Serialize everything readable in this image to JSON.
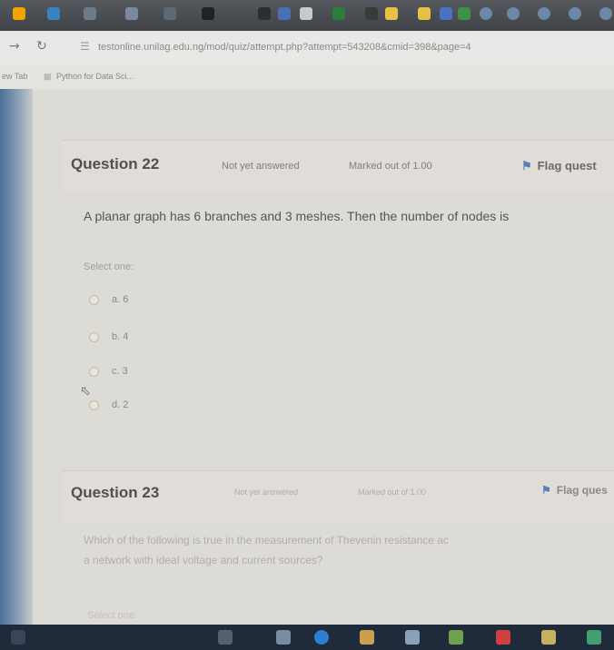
{
  "browser": {
    "url": "testonline.unilag.edu.ng/mod/quiz/attempt.php?attempt=543208&cmid=398&page=4",
    "bookmarks": [
      "ew Tab",
      "Python for Data Sci..."
    ]
  },
  "questions": [
    {
      "number": "Question 22",
      "state": "Not yet answered",
      "marks": "Marked out of 1.00",
      "flag_label": "Flag quest",
      "text": "A planar graph has 6 branches and 3 meshes. Then the number of nodes is",
      "select_label": "Select one:",
      "options": [
        "a. 6",
        "b. 4",
        "c. 3",
        "d. 2"
      ]
    },
    {
      "number": "Question 23",
      "state": "Not yet answered",
      "marks": "Marked out of 1.00",
      "flag_label": "Flag ques",
      "text_line1": "Which of the following is true in the measurement of Thevenin resistance ac",
      "text_line2": "a network with ideal voltage and current sources?",
      "select_label": "Select one:"
    }
  ],
  "icons": {
    "reload": "reload-icon",
    "back": "back-arrow-icon",
    "flag": "flag-icon",
    "radio": "radio-icon",
    "cursor": "mouse-cursor-icon"
  },
  "colors": {
    "page_bg": "#dddbd6",
    "flag_icon": "#5a7fb0",
    "taskbar": "#1f2a3a"
  }
}
